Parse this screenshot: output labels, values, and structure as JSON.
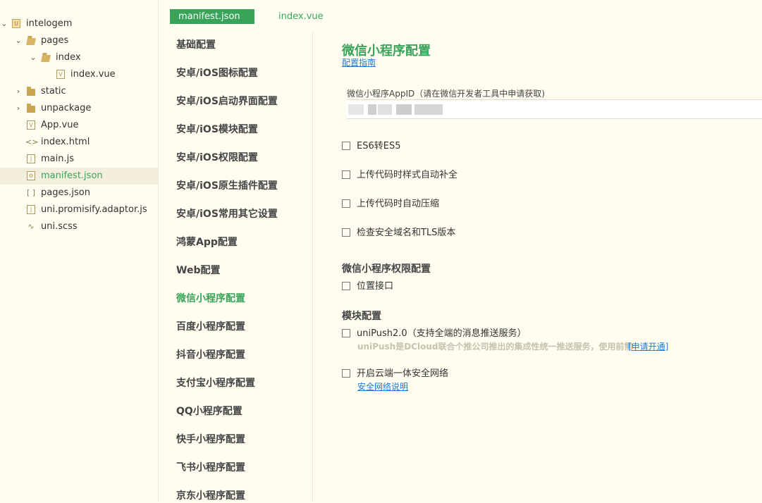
{
  "tree": {
    "project": "intelogem",
    "items": [
      {
        "label": "pages"
      },
      {
        "label": "index"
      },
      {
        "label": "index.vue"
      },
      {
        "label": "static"
      },
      {
        "label": "unpackage"
      },
      {
        "label": "App.vue"
      },
      {
        "label": "index.html"
      },
      {
        "label": "main.js"
      },
      {
        "label": "manifest.json"
      },
      {
        "label": "pages.json"
      },
      {
        "label": "uni.promisify.adaptor.js"
      },
      {
        "label": "uni.scss"
      }
    ]
  },
  "tabs": [
    {
      "label": "manifest.json"
    },
    {
      "label": "index.vue"
    }
  ],
  "nav": {
    "items": [
      {
        "label": "基础配置"
      },
      {
        "label": "安卓/iOS图标配置"
      },
      {
        "label": "安卓/iOS启动界面配置"
      },
      {
        "label": "安卓/iOS模块配置"
      },
      {
        "label": "安卓/iOS权限配置"
      },
      {
        "label": "安卓/iOS原生插件配置"
      },
      {
        "label": "安卓/iOS常用其它设置"
      },
      {
        "label": "鸿蒙App配置"
      },
      {
        "label": "Web配置"
      },
      {
        "label": "微信小程序配置"
      },
      {
        "label": "百度小程序配置"
      },
      {
        "label": "抖音小程序配置"
      },
      {
        "label": "支付宝小程序配置"
      },
      {
        "label": "QQ小程序配置"
      },
      {
        "label": "快手小程序配置"
      },
      {
        "label": "飞书小程序配置"
      },
      {
        "label": "京东小程序配置"
      }
    ],
    "active_index": 9
  },
  "content": {
    "title": "微信小程序配置",
    "guide_link": "配置指南",
    "appid_label": "微信小程序AppID（请在微信开发者工具中申请获取)",
    "checks": [
      {
        "label": "ES6转ES5",
        "checked": false
      },
      {
        "label": "上传代码时样式自动补全",
        "checked": false
      },
      {
        "label": "上传代码时自动压缩",
        "checked": false
      },
      {
        "label": "检查安全域名和TLS版本",
        "checked": false
      }
    ],
    "permission_section": "微信小程序权限配置",
    "location_label": "位置接口",
    "module_section": "模块配置",
    "unipush_label": "uniPush2.0（支持全端的消息推送服务）",
    "unipush_desc": "uniPush是DCloud联合个推公司推出的集成性统一推送服务，使用前需",
    "unipush_link": "[申请开通]",
    "secure_label": "开启云端一体安全网络",
    "secure_link": "安全网络说明"
  },
  "colors": {
    "accent": "#3aa35a",
    "background": "#fffdf0",
    "link": "#1e7bd1"
  }
}
